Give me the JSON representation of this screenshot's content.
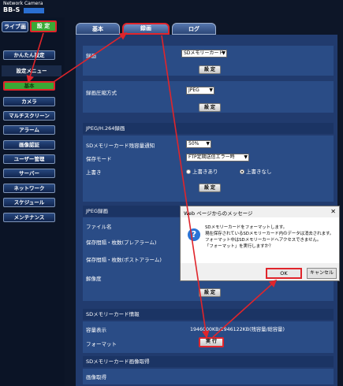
{
  "header": {
    "brand": "Network Camera",
    "model": "BB-S"
  },
  "top_buttons": {
    "live": "ライブ画",
    "settings": "設 定"
  },
  "sidebar": {
    "easy_setup": "かんたん設定",
    "menu_header": "設定メニュー",
    "items": [
      "基本",
      "カメラ",
      "マルチスクリーン",
      "アラーム",
      "画像認証",
      "ユーザー管理",
      "サーバー",
      "ネットワーク",
      "スケジュール",
      "メンテナンス"
    ]
  },
  "tabs": [
    "基本",
    "録画",
    "ログ"
  ],
  "recording": {
    "label": "録画",
    "value": "SDメモリーカード",
    "set_button": "設 定"
  },
  "compression": {
    "label": "録画圧縮方式",
    "value": "JPEG",
    "set_button": "設 定"
  },
  "jpeg_h264": {
    "section": "JPEG/H.264録画",
    "rows": [
      {
        "label": "SDメモリーカード残容量通知",
        "value": "50%"
      },
      {
        "label": "保存モード",
        "value": "FTP定期送信エラー時"
      }
    ],
    "overwrite": {
      "label": "上書き",
      "options": [
        "上書きあり",
        "上書きなし"
      ],
      "selected": "上書きなし"
    },
    "set_button": "設 定"
  },
  "jpeg_rec": {
    "section": "JPEG録画",
    "rows": [
      "ファイル名",
      "保存間隔・枚数(プレアラーム)",
      "保存間隔・枚数(ポストアラーム)",
      "解像度"
    ],
    "set_button": "設 定"
  },
  "sd_info": {
    "section": "SDメモリーカード情報",
    "capacity_label": "容量表示",
    "capacity_value": "1946000KB/1946122KB(残容量/総容量)",
    "format_label": "フォーマット",
    "format_button": "実 行"
  },
  "sd_image": {
    "section": "SDメモリーカード画像取得",
    "label": "画像取得"
  },
  "dialog": {
    "title": "Web ページからのメッセージ",
    "close": "✕",
    "icon": "?",
    "lines": [
      "SDメモリーカードをフォーマットします。",
      "現在保存されているSDメモリーカード内のデータは消去されます。",
      "フォーマット中はSDメモリーカードへアクセスできません。",
      "「フォーマット」を実行しますか？"
    ],
    "ok": "OK",
    "cancel": "キャンセル"
  },
  "colors": {
    "annotation_red": "#e0252b",
    "set_green": "#3aa935",
    "panel_blue": "#213b6e"
  }
}
